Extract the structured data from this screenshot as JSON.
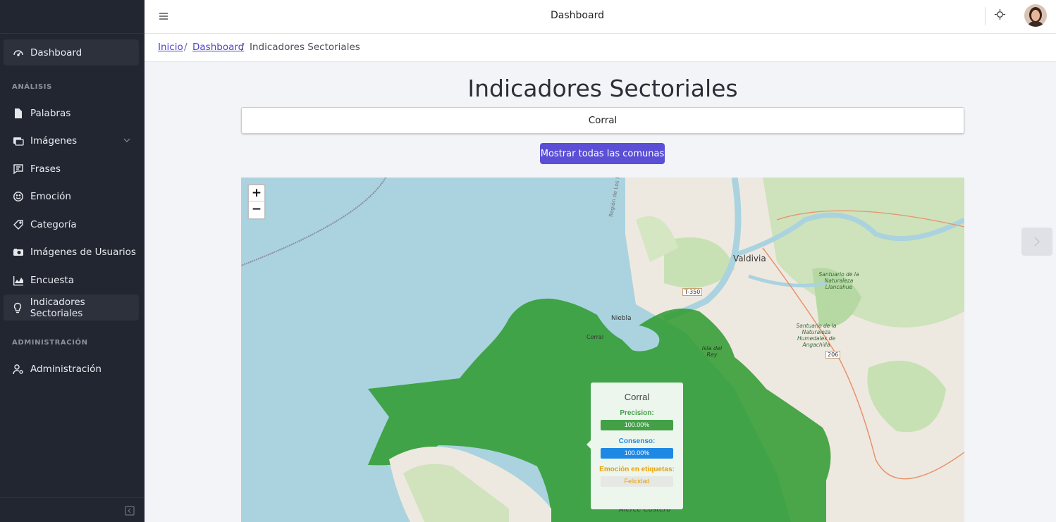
{
  "header": {
    "title": "Dashboard"
  },
  "breadcrumb": {
    "home": "Inicio",
    "dashboard": "Dashboard",
    "current": "Indicadores Sectoriales"
  },
  "sidebar": {
    "items": [
      {
        "label": "Dashboard",
        "icon": "speedometer-icon"
      },
      {
        "label": "Palabras",
        "icon": "file-icon"
      },
      {
        "label": "Imágenes",
        "icon": "images-icon"
      },
      {
        "label": "Frases",
        "icon": "comment-icon"
      },
      {
        "label": "Emoción",
        "icon": "smile-icon"
      },
      {
        "label": "Categoría",
        "icon": "tag-icon"
      },
      {
        "label": "Imágenes de Usuarios",
        "icon": "camera-icon"
      },
      {
        "label": "Encuesta",
        "icon": "chart-icon"
      },
      {
        "label": "Indicadores Sectoriales",
        "icon": "lightbulb-icon"
      },
      {
        "label": "Administración",
        "icon": "user-gear-icon"
      }
    ],
    "sections": {
      "analysis": "ANÁLISIS",
      "admin": "ADMINISTRACIÓN"
    }
  },
  "main": {
    "title": "Indicadores Sectoriales",
    "selected_commune": "Corral",
    "show_all_button": "Mostrar todas las comunas"
  },
  "map": {
    "zoom_in": "+",
    "zoom_out": "−",
    "labels": {
      "valdivia": "Valdivia",
      "niebla": "Niebla",
      "corral_town": "Corral",
      "isla": "Isla del Rey",
      "santuario1": "Santuario de la Naturaleza Llancahue",
      "santuario2": "Santuario de la Naturaleza Humedales de Angachilla",
      "road_t350": "T-350",
      "road_206": "206",
      "alerce": "Alerce Costero",
      "los_rios": "Región de Los Ríos"
    },
    "colors": {
      "water": "#aad3df",
      "land": "#eee9e0",
      "forest": "#b6d9a3",
      "region": "#2e9a2e"
    },
    "popup": {
      "title": "Corral",
      "precision_label": "Precision:",
      "precision_value": "100.00%",
      "precision_fraction": 1.0,
      "consensus_label": "Consenso:",
      "consensus_value": "100.00%",
      "consensus_fraction": 1.0,
      "emotion_label": "Emoción en etiquetas:",
      "emotion_value": "Felicidad",
      "precision_color": "#43a047",
      "consensus_color": "#1e88e5",
      "emotion_color": "#e8a00c"
    }
  }
}
